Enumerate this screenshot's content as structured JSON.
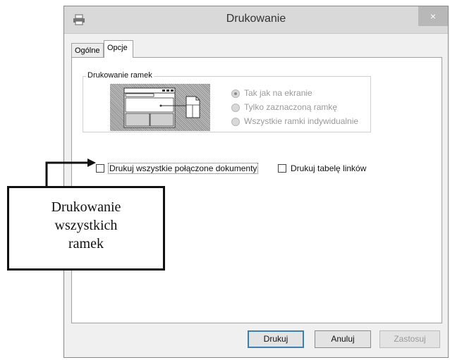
{
  "window": {
    "title": "Drukowanie",
    "close_symbol": "×"
  },
  "tabs": [
    {
      "label": "Ogólne",
      "active": false
    },
    {
      "label": "Opcje",
      "active": true
    }
  ],
  "frames_group": {
    "legend": "Drukowanie ramek",
    "options": [
      {
        "label": "Tak jak na ekranie",
        "selected": true
      },
      {
        "label": "Tylko zaznaczoną ramkę",
        "selected": false
      },
      {
        "label": "Wszystkie ramki indywidualnie",
        "selected": false
      }
    ]
  },
  "checkboxes": {
    "print_linked_docs": {
      "label": "Drukuj wszystkie połączone dokumenty",
      "checked": false
    },
    "print_link_table": {
      "label": "Drukuj tabelę linków",
      "checked": false
    }
  },
  "buttons": {
    "print": "Drukuj",
    "cancel": "Anuluj",
    "apply": "Zastosuj"
  },
  "annotation": {
    "lines": [
      "Drukowanie",
      "wszystkich",
      "ramek"
    ]
  }
}
